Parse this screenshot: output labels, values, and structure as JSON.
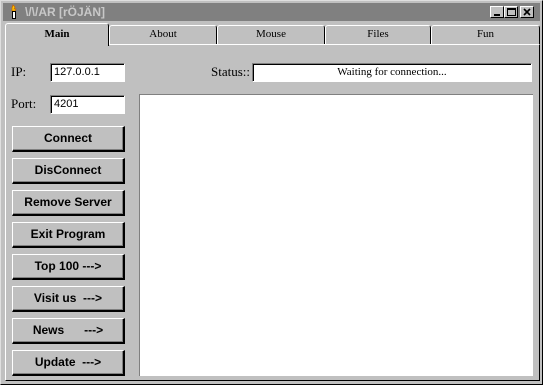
{
  "window": {
    "title": "\\/\\/AR [rÖJÄN]",
    "icon": "torch-icon",
    "controls": [
      "minimize-icon",
      "maximize-icon",
      "close-icon"
    ]
  },
  "tabs": [
    {
      "label": "Main",
      "active": true
    },
    {
      "label": "About",
      "active": false
    },
    {
      "label": "Mouse",
      "active": false
    },
    {
      "label": "Files",
      "active": false
    },
    {
      "label": "Fun",
      "active": false
    }
  ],
  "main": {
    "ip_label": "IP:",
    "ip_value": "127.0.0.1",
    "port_label": "Port:",
    "port_value": "4201",
    "status_label": "Status::",
    "status_value": "Waiting for connection...",
    "buttons": [
      {
        "label": "Connect"
      },
      {
        "label": "DisConnect"
      },
      {
        "label": "Remove Server"
      },
      {
        "label": "Exit Program"
      },
      {
        "label": "Top 100 --->"
      },
      {
        "label": "Visit us  --->"
      },
      {
        "label": "News      --->"
      },
      {
        "label": "Update  --->"
      }
    ],
    "output_text": ""
  },
  "colors": {
    "face": "#c0c0c0",
    "titlebar_inactive": "#808080",
    "title_text": "#c8c8c8",
    "field_bg": "#ffffff"
  }
}
